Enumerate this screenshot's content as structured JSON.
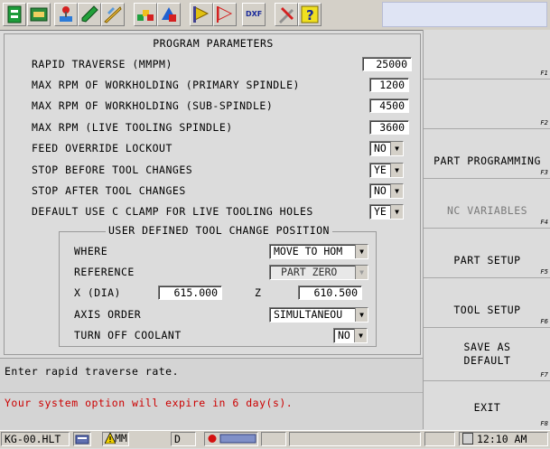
{
  "window": {
    "title": "PROGRAM PARAMETERS"
  },
  "toolbar": {
    "icons": [
      "green-document-icon",
      "keyboard-icon",
      "red-pin-icon",
      "green-pen-icon",
      "pencil-ruler-icon",
      "colored-blocks-icon",
      "shapes-icon",
      "flag-icon",
      "rectangle-outline-icon",
      "dxf-icon",
      "tools-icon",
      "help-icon"
    ],
    "dxf_label": "DXF"
  },
  "params": [
    {
      "label": "RAPID TRAVERSE (MMPM)",
      "value": "25000"
    },
    {
      "label": "MAX RPM OF WORKHOLDING (PRIMARY SPINDLE)",
      "value": "1200"
    },
    {
      "label": "MAX RPM OF WORKHOLDING (SUB-SPINDLE)",
      "value": "4500"
    },
    {
      "label": "MAX RPM (LIVE TOOLING SPINDLE)",
      "value": "3600"
    }
  ],
  "options": [
    {
      "label": "FEED OVERRIDE LOCKOUT",
      "value": "NO"
    },
    {
      "label": "STOP BEFORE TOOL CHANGES",
      "value": "YE"
    },
    {
      "label": "STOP AFTER TOOL CHANGES",
      "value": "NO"
    },
    {
      "label": "DEFAULT USE C CLAMP FOR LIVE TOOLING HOLES",
      "value": "YE"
    }
  ],
  "group": {
    "title": "USER DEFINED TOOL CHANGE POSITION",
    "where_label": "WHERE",
    "where_value": "MOVE TO HOM",
    "reference_label": "REFERENCE",
    "reference_value": "PART ZERO",
    "x_label": "X (DIA)",
    "x_value": "615.000",
    "z_label": "Z",
    "z_value": "610.500",
    "axis_label": "AXIS ORDER",
    "axis_value": "SIMULTANEOU",
    "coolant_label": "TURN OFF COOLANT",
    "coolant_value": "NO"
  },
  "status": {
    "hint": "Enter rapid traverse rate.",
    "warning": "Your system option will expire in 6 day(s).",
    "warning_color": "#cc0000"
  },
  "fkeys": [
    {
      "label": "",
      "fn": "F1"
    },
    {
      "label": "",
      "fn": "F2"
    },
    {
      "label": "PART PROGRAMMING",
      "fn": "F3"
    },
    {
      "label": "NC VARIABLES",
      "fn": "F4"
    },
    {
      "label": "PART SETUP",
      "fn": "F5"
    },
    {
      "label": "TOOL SETUP",
      "fn": "F6"
    },
    {
      "label1": "SAVE AS",
      "label2": "DEFAULT",
      "fn": "F7"
    },
    {
      "label": "EXIT",
      "fn": "F8"
    }
  ],
  "taskbar": {
    "file": "KG-00.HLT",
    "mode": "MM",
    "d": "D",
    "time": "12:10 AM"
  }
}
